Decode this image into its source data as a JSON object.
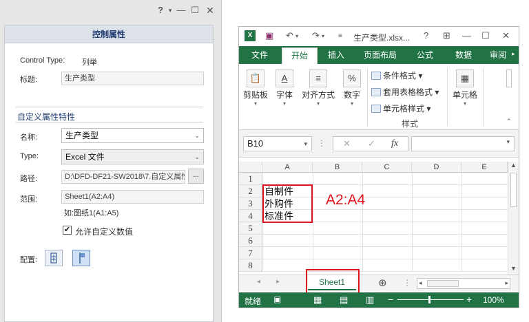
{
  "left_panel": {
    "help_icon": "?",
    "header": "控制属性",
    "control_type_label": "Control Type:",
    "control_type_value": "列举",
    "title_label": "标题:",
    "title_value": "生产类型",
    "section_title": "自定义属性特性",
    "name_label": "名称:",
    "name_value": "生产类型",
    "type_label": "Type:",
    "type_value": "Excel 文件",
    "path_label": "路径:",
    "path_value": "D:\\DFD-DF21-SW2018\\7.自定义属性",
    "browse_label": "...",
    "range_label": "范围:",
    "range_value": "Sheet1(A2:A4)",
    "range_hint": "如:图纸1(A1:A5)",
    "allow_custom_label": "允许自定义数值",
    "allow_custom_checked": true,
    "config_label": "配置:"
  },
  "excel": {
    "file_title": "生产类型.xlsx...",
    "tabs": [
      "文件",
      "开始",
      "插入",
      "页面布局",
      "公式",
      "数据",
      "审阅"
    ],
    "active_tab": "开始",
    "ribbon": {
      "paste": "剪贴板",
      "font": "字体",
      "align": "对齐方式",
      "number": "数字",
      "cond_format": "条件格式",
      "table_format": "套用表格格式",
      "cell_style": "单元格样式",
      "styles_group": "样式",
      "cells": "单元格",
      "font_icon": "A",
      "number_icon": "%"
    },
    "name_box": "B10",
    "fx_label": "fx",
    "columns": [
      "A",
      "B",
      "C",
      "D",
      "E"
    ],
    "rows": [
      "1",
      "2",
      "3",
      "4",
      "5",
      "6",
      "7",
      "8"
    ],
    "cells": {
      "a2": "自制件",
      "a3": "外购件",
      "a4": "标准件"
    },
    "annotation": "A2:A4",
    "sheet_tab": "Sheet1",
    "status_ready": "就绪",
    "zoom": "100%",
    "accent_color": "#217346",
    "highlight_color": "#e0141e"
  }
}
